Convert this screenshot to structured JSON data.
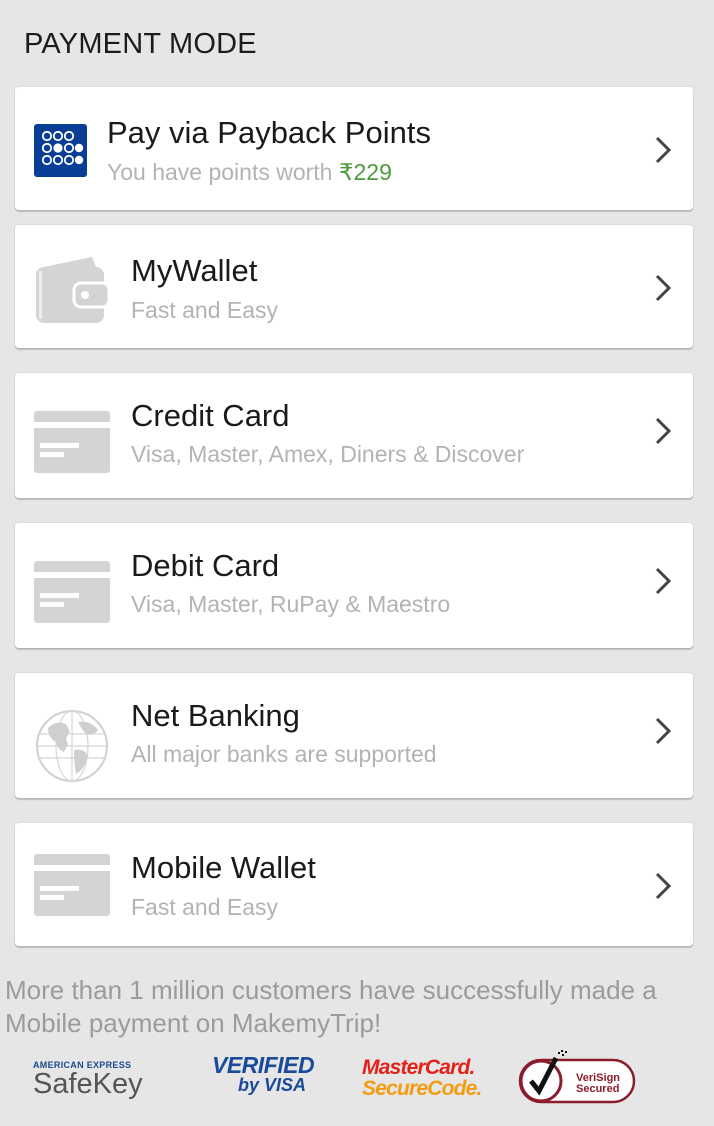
{
  "header": {
    "title": "PAYMENT MODE"
  },
  "payment_options": [
    {
      "title": "Pay via Payback Points",
      "subtitle_prefix": "You have points worth ",
      "subtitle_value": "₹229",
      "icon": "payback-logo-icon"
    },
    {
      "title": "MyWallet",
      "subtitle": "Fast and Easy",
      "icon": "wallet-icon"
    },
    {
      "title": "Credit Card",
      "subtitle": "Visa, Master, Amex, Diners & Discover",
      "icon": "card-icon"
    },
    {
      "title": "Debit Card",
      "subtitle": "Visa, Master, RuPay & Maestro",
      "icon": "card-icon"
    },
    {
      "title": "Net Banking",
      "subtitle": "All major banks are supported",
      "icon": "globe-icon"
    },
    {
      "title": "Mobile Wallet",
      "subtitle": "Fast and Easy",
      "icon": "card-icon"
    }
  ],
  "footer": {
    "message": "More than 1 million customers have successfully made a Mobile payment on MakemyTrip!",
    "badges": {
      "amex_top": "AMERICAN EXPRESS",
      "amex_main": "SafeKey",
      "visa_top": "VERIFIED",
      "visa_bottom": "by VISA",
      "mc_top": "MasterCard.",
      "mc_bottom": "SecureCode.",
      "verisign_top": "VeriSign",
      "verisign_bottom": "Secured"
    }
  },
  "colors": {
    "background": "#e6e6e6",
    "card": "#ffffff",
    "points_green": "#4d9a3c",
    "payback_blue": "#0a3d96",
    "mastercard_red": "#e2231a",
    "verisign_red": "#8b1c2c"
  }
}
